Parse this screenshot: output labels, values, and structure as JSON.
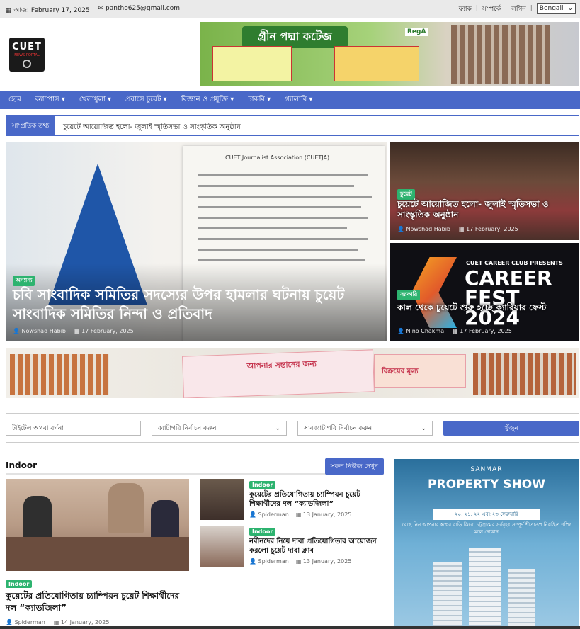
{
  "topbar": {
    "date": "আজ: February 17, 2025",
    "email": "pantho625@gmail.com",
    "links": [
      "ফ্যাক",
      "সম্পর্কে",
      "লগিন"
    ],
    "language": "Bengali"
  },
  "header": {
    "logo": {
      "line1": "CUET",
      "line2": "NEWS PORTAL"
    },
    "ad_top": {
      "title": "গ্রীন পদ্মা কটেজ",
      "brand": "RegA"
    }
  },
  "nav": {
    "items": [
      "হোম",
      "ক্যাম্পাস ▾",
      "খেলাধুলা ▾",
      "প্রবাসে চুয়েট ▾",
      "বিজ্ঞান ও প্রযুক্তি ▾",
      "চাকরি ▾",
      "গ্যালারি ▾"
    ]
  },
  "ticker": {
    "label": "সাম্প্রতিক তথ্য",
    "text": "চুয়েটে আয়োজিত হলো- জুলাই স্মৃতিসভা ও সাংস্কৃতিক অনুষ্ঠান"
  },
  "hero": {
    "paper_header": "CUET Journalist Association (CUETJA)",
    "category": "অন্যান্য",
    "title": "চবি সাংবাদিক সমিতির সদস্যের উপর হামলার ঘটনায় চুয়েট সাংবাদিক সমিতির নিন্দা ও প্রতিবাদ",
    "author": "Nowshad Habib",
    "date": "17 February, 2025"
  },
  "side_stories": [
    {
      "category": "চুয়েট",
      "title": "চুয়েটে আয়োজিত হলো- জুলাই স্মৃতিসভা ও সাংস্কৃতিক অনুষ্ঠান",
      "author": "Nowshad Habib",
      "date": "17 February, 2025"
    },
    {
      "category": "সরকারি",
      "title": "কাল থেকে চুয়েটে শুরু হচ্ছে ক্যারিয়ার ফেস্ট",
      "author": "Nino Chakma",
      "date": "17 February, 2025",
      "banner_top": "CUET CAREER CLUB PRESENTS",
      "banner_big": "CAREER FEST 2024"
    }
  ],
  "ad_middle": {
    "text": "আপনার সন্তানের জন্য",
    "sub": "বিক্রয়ের মূল্য"
  },
  "filters": {
    "title_placeholder": "টাইটেল অথবা বর্ণনা",
    "category": "ক্যাটাগরি নির্বাচন করুন",
    "subcategory": "সাবক্যাটাগরি নির্বাচন করুন",
    "button": "খুঁজুন"
  },
  "section": {
    "heading": "Indoor",
    "all_button": "সকল নিউজ দেখুন",
    "main": {
      "category": "Indoor",
      "title": "কুয়েটের প্রতিযোগিতায় চ্যাম্পিয়ন চুয়েট শিক্ষার্থীদের দল “ক্যাডজিলা”",
      "author": "Spiderman",
      "date": "14 January, 2025"
    },
    "list": [
      {
        "category": "Indoor",
        "title": "কুয়েটের প্রতিযোগিতায় চ্যাম্পিয়ন চুয়েট শিক্ষার্থীদের দল “ক্যাডজিলা”",
        "author": "Spiderman",
        "date": "13 January, 2025"
      },
      {
        "category": "Indoor",
        "title": "নবীনদের নিয়ে দাবা প্রতিযোগিতার আয়োজন করলো চুয়েট দাবা ক্লাব",
        "author": "Spiderman",
        "date": "13 January, 2025"
      }
    ]
  },
  "ad_right": {
    "brand": "SANMAR",
    "title": "PROPERTY SHOW",
    "dates": "২০, ২১, ২২ এবং ২৩ ফেব্রুয়ারি",
    "desc": "বেছে নিন আপনার স্বপ্নের বাড়ি কিংবা চট্টগ্রামের সর্ববৃহৎ সম্পূর্ণ শীতাতপ নিয়ন্ত্রিত শপিং মলে দোকান"
  },
  "icons": {
    "calendar": "calendar-icon",
    "user": "user-icon",
    "mail": "mail-icon"
  },
  "colors": {
    "accent": "#4968c8",
    "category": "#2db36f"
  }
}
